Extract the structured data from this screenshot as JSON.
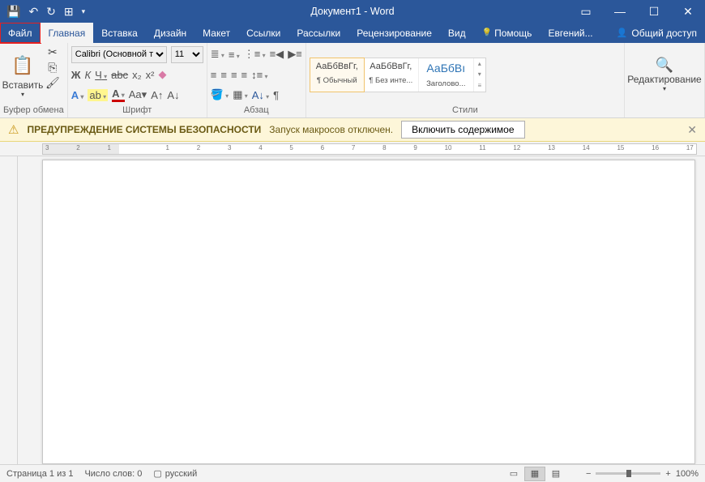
{
  "title": "Документ1 - Word",
  "tabs": {
    "file": "Файл",
    "home": "Главная",
    "insert": "Вставка",
    "design": "Дизайн",
    "layout": "Макет",
    "references": "Ссылки",
    "mailings": "Рассылки",
    "review": "Рецензирование",
    "view": "Вид",
    "help": "Помощь"
  },
  "user": "Евгений...",
  "share": "Общий доступ",
  "clipboard": {
    "paste": "Вставить",
    "label": "Буфер обмена"
  },
  "font": {
    "name": "Calibri (Основной тек",
    "size": "11",
    "label": "Шрифт"
  },
  "paragraph": {
    "label": "Абзац"
  },
  "styles": {
    "label": "Стили",
    "items": [
      {
        "preview": "АаБбВвГг,",
        "name": "¶ Обычный"
      },
      {
        "preview": "АаБбВвГг,",
        "name": "¶ Без инте..."
      },
      {
        "preview": "АаБбВı",
        "name": "Заголово..."
      }
    ]
  },
  "editing": {
    "label": "Редактирование"
  },
  "warning": {
    "title": "ПРЕДУПРЕЖДЕНИЕ СИСТЕМЫ БЕЗОПАСНОСТИ",
    "msg": "Запуск макросов отключен.",
    "btn": "Включить содержимое"
  },
  "ruler_nums": [
    "3",
    "2",
    "1",
    "",
    "1",
    "2",
    "3",
    "4",
    "5",
    "6",
    "7",
    "8",
    "9",
    "10",
    "11",
    "12",
    "13",
    "14",
    "15",
    "16",
    "17"
  ],
  "status": {
    "page": "Страница 1 из 1",
    "words": "Число слов: 0",
    "lang": "русский",
    "zoom": "100%"
  }
}
